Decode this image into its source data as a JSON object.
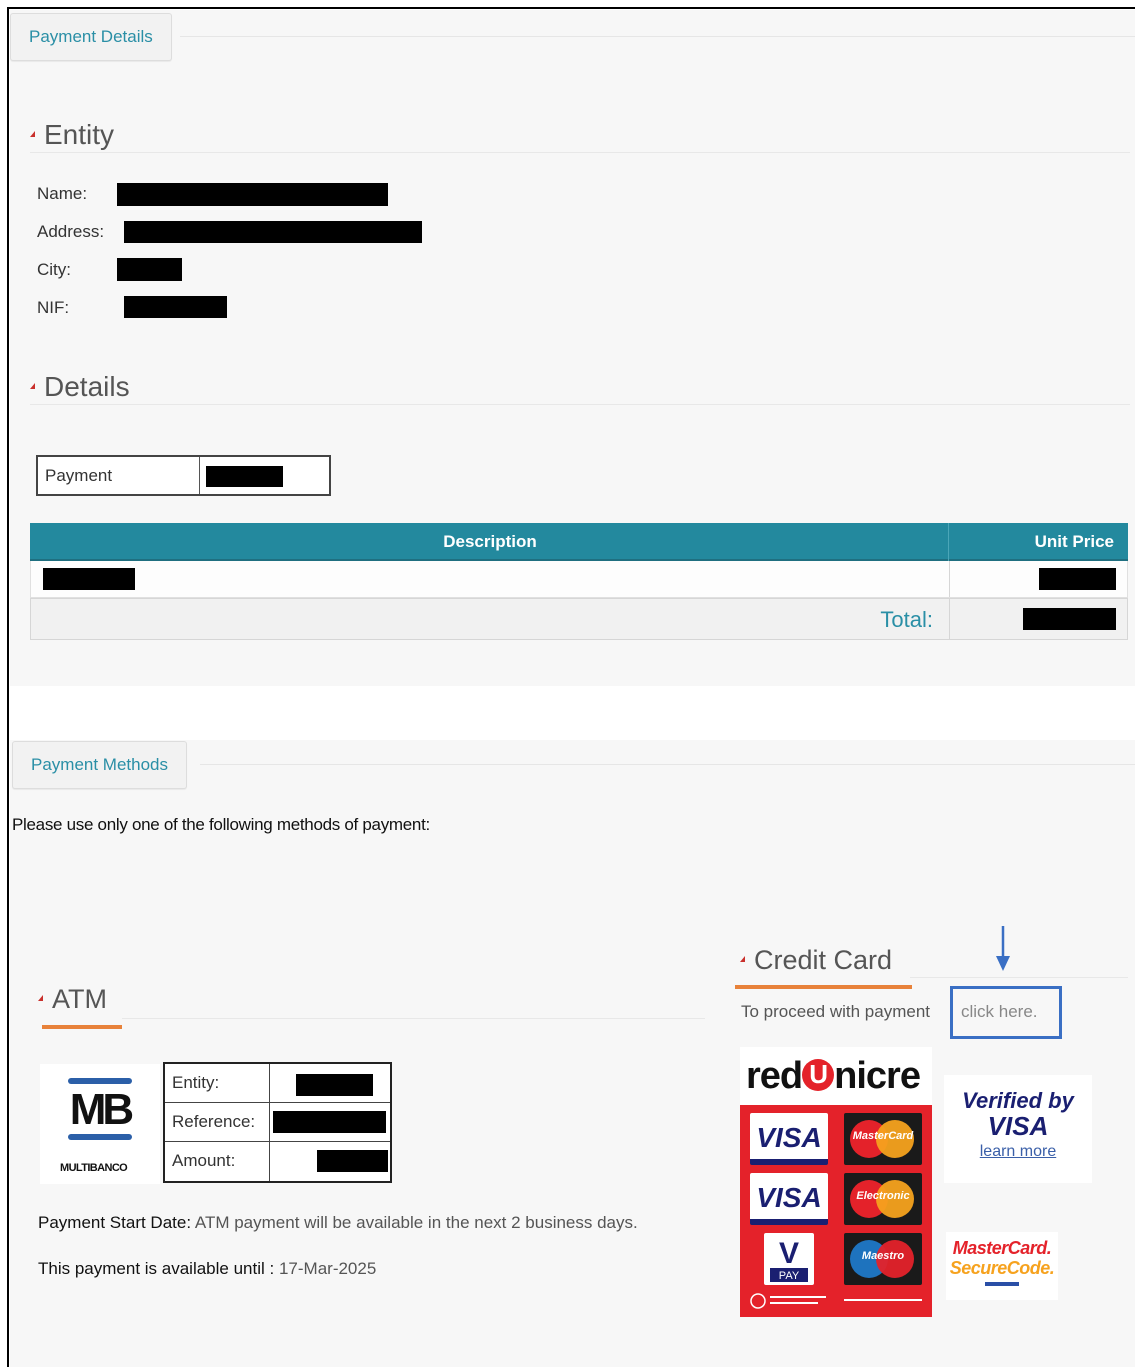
{
  "payment_details": {
    "tab_label": "Payment Details",
    "entity": {
      "title": "Entity",
      "fields": [
        {
          "label": "Name:"
        },
        {
          "label": "Address:"
        },
        {
          "label": "City:"
        },
        {
          "label": "NIF:"
        }
      ]
    },
    "details": {
      "title": "Details",
      "payment_label": "Payment",
      "table": {
        "columns": [
          "Description",
          "Unit Price"
        ],
        "total_label": "Total:"
      }
    }
  },
  "payment_methods": {
    "tab_label": "Payment Methods",
    "instruction": "Please use only one of the following methods of payment:",
    "atm": {
      "title": "ATM",
      "logo_text": "MB",
      "logo_subtext": "MULTIBANCO",
      "rows": [
        {
          "label": "Entity:"
        },
        {
          "label": "Reference:"
        },
        {
          "label": "Amount:"
        }
      ],
      "start_date_label": "Payment Start Date:",
      "start_date_text": "ATM payment will be available in the next 2 business days.",
      "available_label": "This payment is available until :",
      "available_date": "17-Mar-2025"
    },
    "credit_card": {
      "title": "Credit Card",
      "proceed_text": "To proceed with payment",
      "click_here": "click here.",
      "redunicre_logo": "redunicre",
      "verified_by": "Verified by",
      "verified_visa": "VISA",
      "learn_more": "learn more",
      "mc_secure_1": "MasterCard.",
      "mc_secure_2": "SecureCode."
    }
  },
  "colors": {
    "teal": "#23899e",
    "tab_text": "#2a8fa6",
    "orange_accent": "#e8823a",
    "caret_red": "#c9302c",
    "highlight_blue": "#3a6fc4"
  }
}
